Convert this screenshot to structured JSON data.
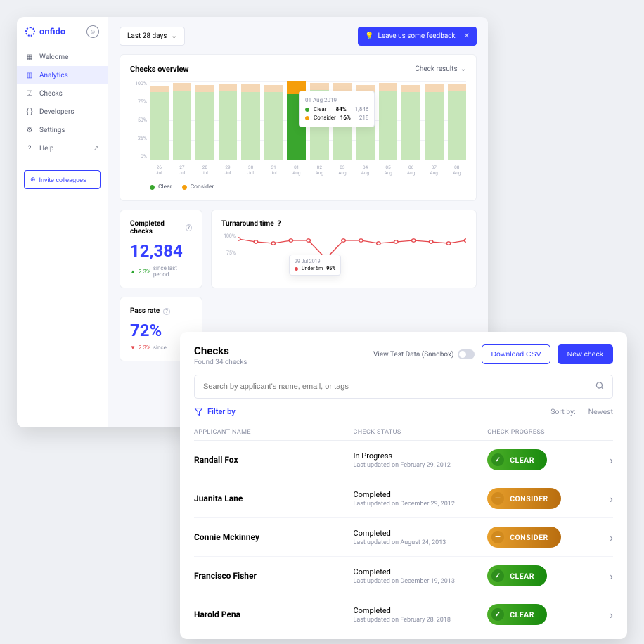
{
  "brand": "onfido",
  "sidebar": {
    "items": [
      {
        "label": "Welcome",
        "key": "welcome"
      },
      {
        "label": "Analytics",
        "key": "analytics",
        "active": true
      },
      {
        "label": "Checks",
        "key": "checks"
      },
      {
        "label": "Developers",
        "key": "developers"
      },
      {
        "label": "Settings",
        "key": "settings"
      },
      {
        "label": "Help",
        "key": "help",
        "external": true
      }
    ],
    "invite_label": "Invite colleagues"
  },
  "topbar": {
    "range_label": "Last 28 days",
    "feedback_label": "Leave us some feedback"
  },
  "overview": {
    "title": "Checks overview",
    "selector_label": "Check results",
    "legend": {
      "clear": "Clear",
      "consider": "Consider"
    },
    "tooltip": {
      "date": "01 Aug 2019",
      "rows": [
        {
          "label": "Clear",
          "pct": "84%",
          "count": "1,846",
          "color": "#3aa62e"
        },
        {
          "label": "Consider",
          "pct": "16%",
          "count": "218",
          "color": "#f59e0b"
        }
      ]
    }
  },
  "chart_data": {
    "type": "bar",
    "stacked": true,
    "ylim": [
      0,
      100
    ],
    "yticks": [
      "100%",
      "75%",
      "50%",
      "25%",
      "0%"
    ],
    "categories": [
      {
        "d": "26",
        "m": "Jul"
      },
      {
        "d": "27",
        "m": "Jul"
      },
      {
        "d": "28",
        "m": "Jul"
      },
      {
        "d": "29",
        "m": "Jul"
      },
      {
        "d": "30",
        "m": "Jul"
      },
      {
        "d": "31",
        "m": "Jul"
      },
      {
        "d": "01",
        "m": "Aug"
      },
      {
        "d": "02",
        "m": "Aug"
      },
      {
        "d": "03",
        "m": "Aug"
      },
      {
        "d": "04",
        "m": "Aug"
      },
      {
        "d": "05",
        "m": "Aug"
      },
      {
        "d": "06",
        "m": "Aug"
      },
      {
        "d": "07",
        "m": "Aug"
      },
      {
        "d": "08",
        "m": "Aug"
      }
    ],
    "series": [
      {
        "name": "Clear",
        "color": "#c7e6b9",
        "values": [
          86,
          87,
          86,
          87,
          86,
          86,
          84,
          88,
          87,
          86,
          87,
          86,
          86,
          87
        ]
      },
      {
        "name": "Consider",
        "color": "#f5d7b5",
        "values": [
          8,
          10,
          9,
          9,
          10,
          9,
          16,
          9,
          10,
          9,
          10,
          9,
          10,
          9
        ]
      }
    ],
    "highlight_index": 6
  },
  "kpi": {
    "completed": {
      "label": "Completed checks",
      "value": "12,384",
      "delta_pct": "2.3%",
      "delta_text": "since last period",
      "dir": "up"
    },
    "pass": {
      "label": "Pass rate",
      "value": "72%",
      "delta_pct": "2.3%",
      "delta_text": "since",
      "dir": "down"
    }
  },
  "turnaround": {
    "label": "Turnaround time",
    "yticks": [
      "100%",
      "75%"
    ],
    "tooltip": {
      "date": "29 Jul 2019",
      "label": "Under 5m",
      "pct": "95%"
    },
    "series": [
      96,
      94,
      93,
      95,
      95,
      82,
      95,
      95,
      93,
      94,
      95,
      94,
      93,
      95
    ]
  },
  "checks": {
    "title": "Checks",
    "subtitle": "Found 34 checks",
    "sandbox_label": "View Test Data (Sandbox)",
    "download_label": "Download CSV",
    "new_label": "New check",
    "search_placeholder": "Search by applicant's name, email, or tags",
    "filter_label": "Filter by",
    "sort_label": "Sort by:",
    "sort_value": "Newest",
    "columns": {
      "name": "APPLICANT NAME",
      "status": "CHECK STATUS",
      "progress": "CHECK PROGRESS"
    },
    "rows": [
      {
        "name": "Randall Fox",
        "status": "In Progress",
        "updated": "Last updated on February 29, 2012",
        "progress": "CLEAR",
        "kind": "clear"
      },
      {
        "name": "Juanita Lane",
        "status": "Completed",
        "updated": "Last updated on December 29, 2012",
        "progress": "CONSIDER",
        "kind": "consider"
      },
      {
        "name": "Connie Mckinney",
        "status": "Completed",
        "updated": "Last updated on August 24, 2013",
        "progress": "CONSIDER",
        "kind": "consider"
      },
      {
        "name": "Francisco Fisher",
        "status": "Completed",
        "updated": "Last updated on December 19, 2013",
        "progress": "CLEAR",
        "kind": "clear"
      },
      {
        "name": "Harold Pena",
        "status": "Completed",
        "updated": "Last updated on February 28, 2018",
        "progress": "CLEAR",
        "kind": "clear"
      }
    ]
  }
}
